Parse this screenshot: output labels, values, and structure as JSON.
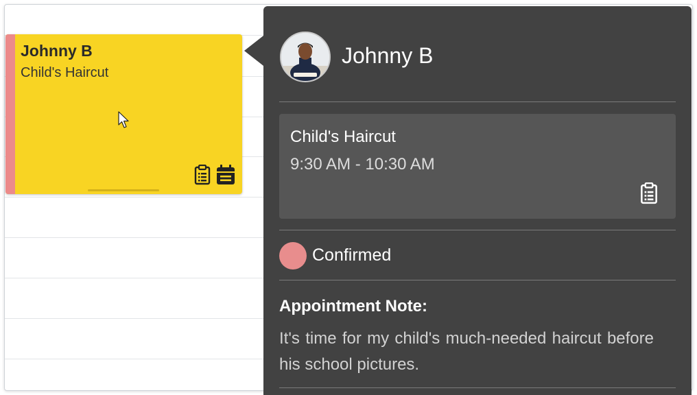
{
  "colors": {
    "event_background": "#f8d423",
    "event_accent": "#ec8a8a",
    "popover_background": "#424242",
    "service_box_background": "#565656",
    "status_confirmed": "#e88d8d"
  },
  "event_card": {
    "client_name": "Johnny B",
    "service": "Child's Haircut",
    "icons": [
      "clipboard-icon",
      "calendar-icon"
    ]
  },
  "popover": {
    "client_name": "Johnny B",
    "avatar_icon": "client-avatar",
    "service": {
      "name": "Child's Haircut",
      "time": "9:30 AM - 10:30 AM",
      "icon": "clipboard-icon"
    },
    "status": {
      "label": "Confirmed",
      "color": "#e88d8d"
    },
    "note": {
      "heading": "Appointment Note:",
      "body": "It's time for my child's much-needed haircut before his school pictures."
    }
  }
}
